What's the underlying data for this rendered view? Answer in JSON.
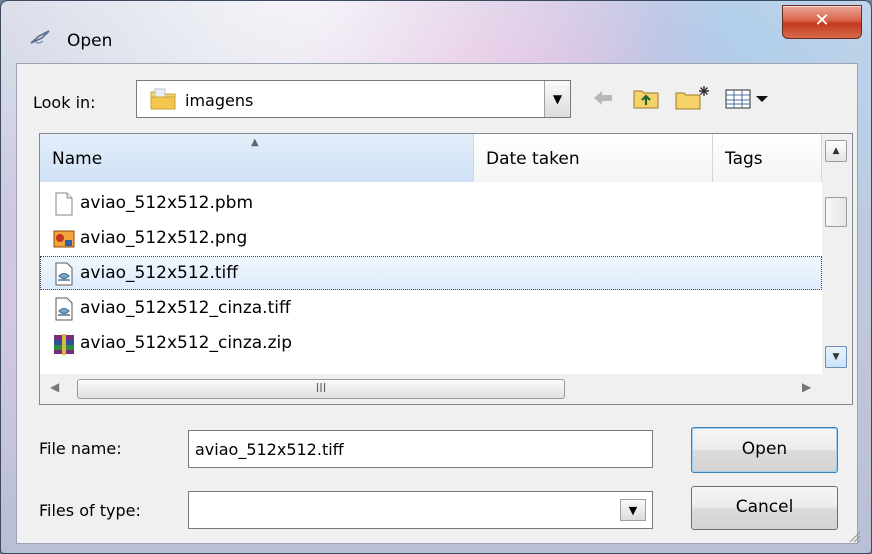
{
  "window": {
    "title": "Open",
    "close_glyph": "✕"
  },
  "toolbar": {
    "look_in_label": "Look in:",
    "look_in_underline": "i",
    "look_in_value": "imagens",
    "icons": [
      "back-arrow-icon",
      "up-folder-icon",
      "new-folder-icon",
      "view-menu-icon"
    ]
  },
  "columns": {
    "name": "Name",
    "date": "Date taken",
    "tags": "Tags"
  },
  "files": [
    {
      "name": "aviao_512x512.pbm",
      "icon": "blank-file-icon"
    },
    {
      "name": "aviao_512x512.png",
      "icon": "image-file-icon"
    },
    {
      "name": "aviao_512x512.tiff",
      "icon": "tiff-file-icon",
      "selected": true
    },
    {
      "name": "aviao_512x512_cinza.tiff",
      "icon": "tiff-file-icon"
    },
    {
      "name": "aviao_512x512_cinza.zip",
      "icon": "rar-archive-icon"
    }
  ],
  "scroll": {
    "hthumb_grip": "III"
  },
  "form": {
    "file_name_label": "File name:",
    "file_name_value": "aviao_512x512.tiff",
    "files_of_type_label": "Files of type:",
    "files_of_type_value": ""
  },
  "buttons": {
    "open": "Open",
    "cancel": "Cancel"
  },
  "colors": {
    "close_red": "#c23a1f",
    "selection": "#dcebfb",
    "focus_blue": "#3c7fb1"
  }
}
